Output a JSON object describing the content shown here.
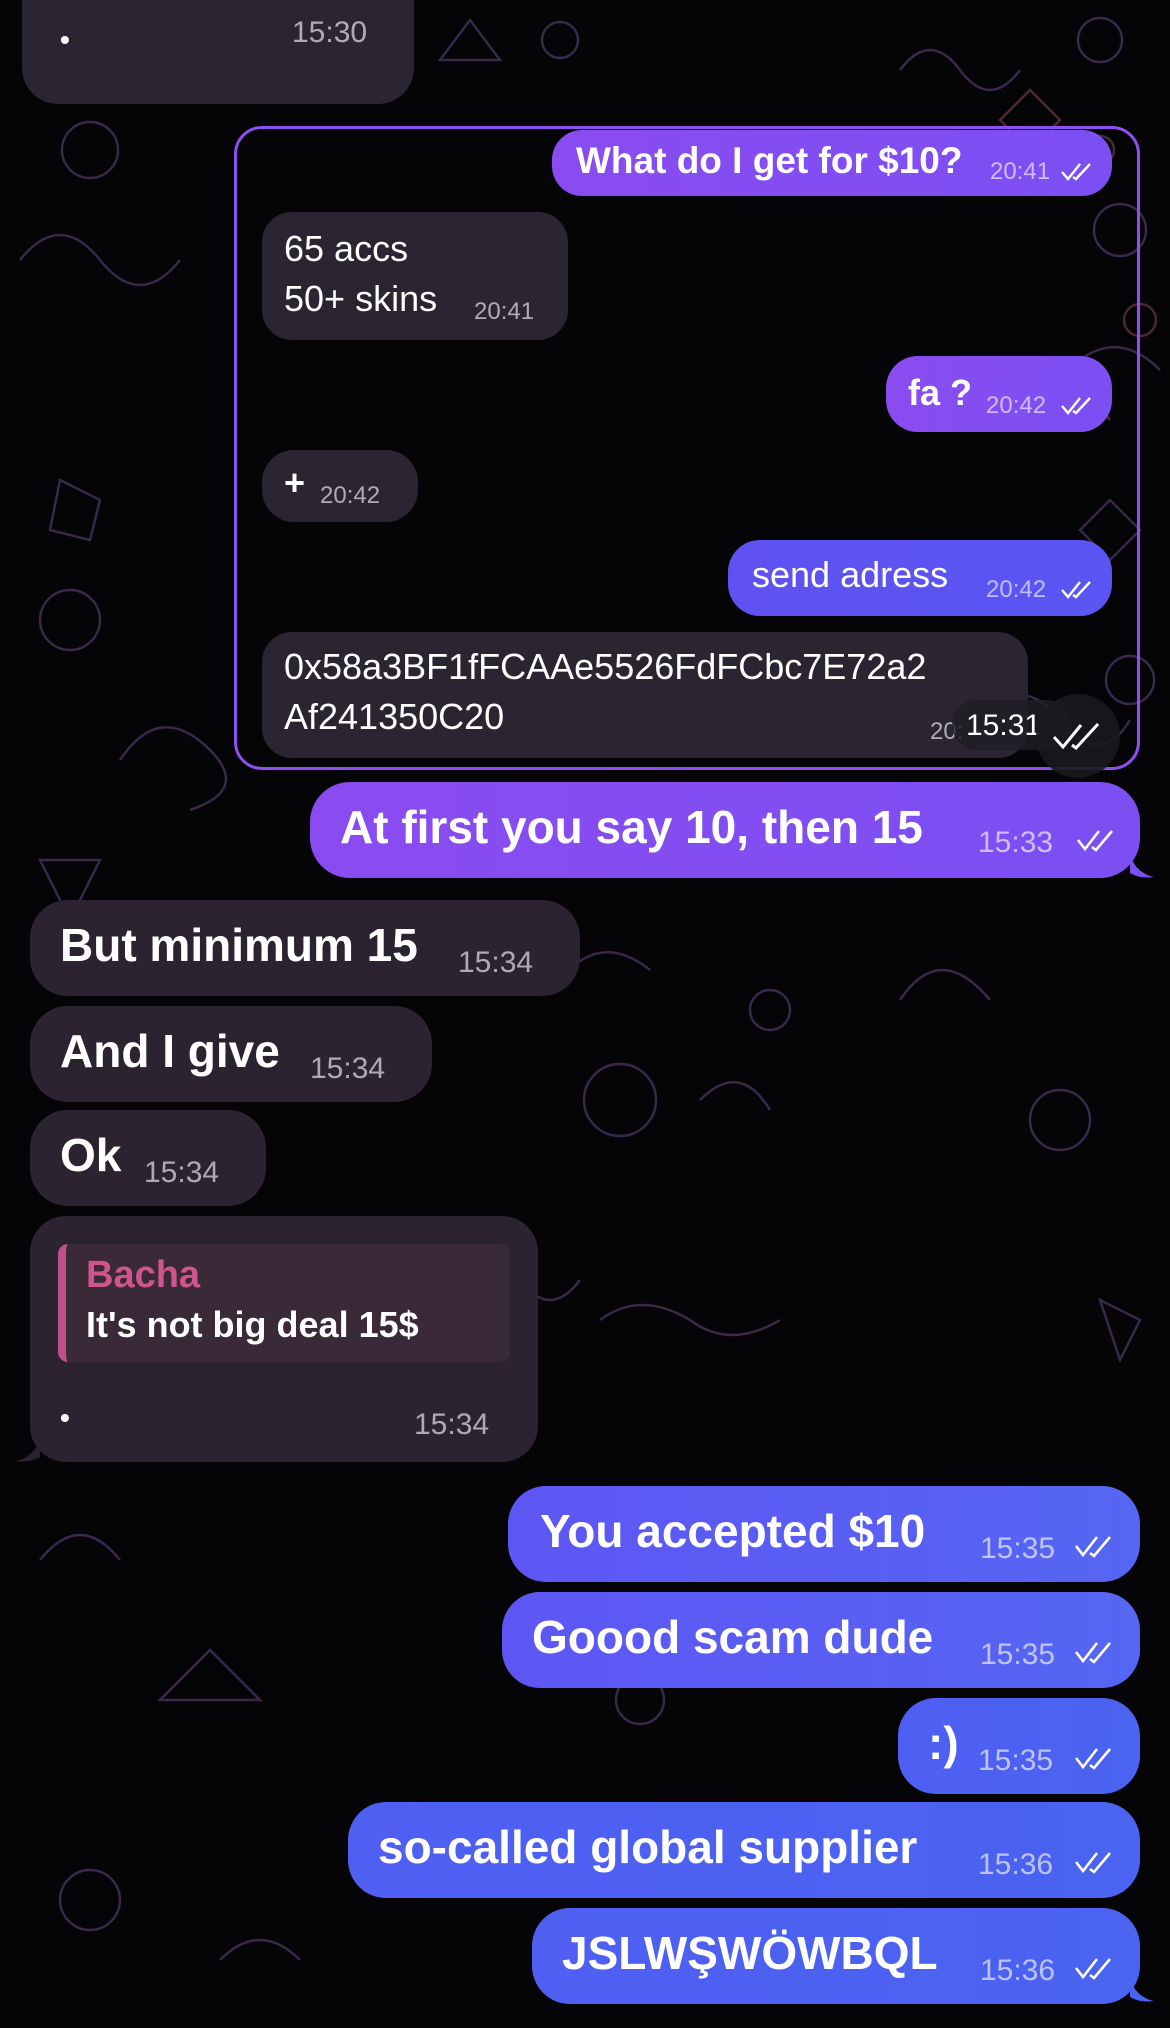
{
  "top_message": {
    "text": "•",
    "time": "15:30"
  },
  "forwarded_screenshot": {
    "messages": [
      {
        "type": "out",
        "text": "What do I get for $10?",
        "time": "20:41"
      },
      {
        "type": "in",
        "lines": [
          "65 accs",
          "50+ skins"
        ],
        "time": "20:41"
      },
      {
        "type": "out",
        "text": "fa ?",
        "time": "20:42"
      },
      {
        "type": "in",
        "text": "+",
        "time": "20:42"
      },
      {
        "type": "out",
        "text": "send adress",
        "time": "20:42"
      },
      {
        "type": "in",
        "lines": [
          "0x58a3BF1fFCAAe5526FdFCbc7E72a2",
          "Af241350C20"
        ],
        "time": "20:"
      }
    ],
    "overlay_time": "15:31"
  },
  "messages": [
    {
      "type": "out",
      "text": "At first you say 10, then 15",
      "time": "15:33"
    },
    {
      "type": "in",
      "text": "But minimum 15",
      "time": "15:34"
    },
    {
      "type": "in",
      "text": "And I give",
      "time": "15:34"
    },
    {
      "type": "in",
      "text": "Ok",
      "time": "15:34"
    },
    {
      "type": "in",
      "reply_author": "Bacha",
      "reply_text": "It's not big deal 15$",
      "text": "•",
      "time": "15:34"
    },
    {
      "type": "out",
      "text": "You accepted $10",
      "time": "15:35"
    },
    {
      "type": "out",
      "text": "Goood scam dude",
      "time": "15:35"
    },
    {
      "type": "out",
      "text": ":)",
      "time": "15:35"
    },
    {
      "type": "out",
      "text": "so-called global supplier",
      "time": "15:36"
    },
    {
      "type": "out",
      "text": "JSLWŞWÖWBQL",
      "time": "15:36"
    }
  ],
  "colors": {
    "background": "#050507",
    "incoming_bubble": "#2a2530",
    "outgoing_purple": "#8a4cf0",
    "outgoing_blue": "#4f5ff2",
    "reply_accent": "#c0508a",
    "screenshot_border": "#8f4ff0"
  },
  "icons": [
    "double-check-icon",
    "tail-icon"
  ]
}
